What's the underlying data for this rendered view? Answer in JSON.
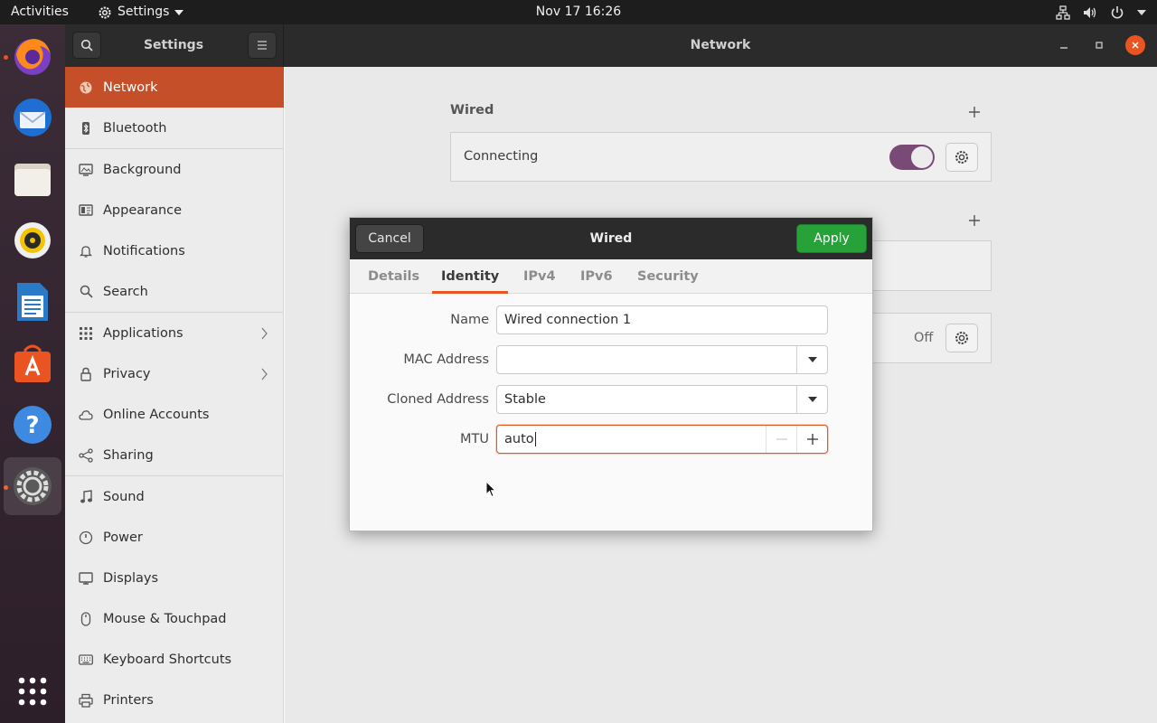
{
  "topbar": {
    "activities": "Activities",
    "app_name": "Settings",
    "clock": "Nov 17  16:26"
  },
  "headerbar": {
    "left_title": "Settings",
    "right_title": "Network"
  },
  "sidebar": {
    "items": [
      {
        "label": "Network",
        "icon": "globe-icon"
      },
      {
        "label": "Bluetooth",
        "icon": "bluetooth-icon"
      },
      {
        "label": "Background",
        "icon": "monitor-icon"
      },
      {
        "label": "Appearance",
        "icon": "appearance-icon"
      },
      {
        "label": "Notifications",
        "icon": "bell-icon"
      },
      {
        "label": "Search",
        "icon": "search-icon"
      },
      {
        "label": "Applications",
        "icon": "grid-icon"
      },
      {
        "label": "Privacy",
        "icon": "lock-icon"
      },
      {
        "label": "Online Accounts",
        "icon": "cloud-icon"
      },
      {
        "label": "Sharing",
        "icon": "share-icon"
      },
      {
        "label": "Sound",
        "icon": "music-note-icon"
      },
      {
        "label": "Power",
        "icon": "power-icon"
      },
      {
        "label": "Displays",
        "icon": "display-icon"
      },
      {
        "label": "Mouse & Touchpad",
        "icon": "mouse-icon"
      },
      {
        "label": "Keyboard Shortcuts",
        "icon": "keyboard-icon"
      },
      {
        "label": "Printers",
        "icon": "printer-icon"
      }
    ]
  },
  "main": {
    "wired_title": "Wired",
    "wired_status": "Connecting",
    "proxy_status": "Off"
  },
  "dialog": {
    "cancel_label": "Cancel",
    "title": "Wired",
    "apply_label": "Apply",
    "tabs": [
      "Details",
      "Identity",
      "IPv4",
      "IPv6",
      "Security"
    ],
    "active_tab": "Identity",
    "fields": {
      "name_label": "Name",
      "name_value": "Wired connection 1",
      "mac_label": "MAC Address",
      "mac_value": "",
      "cloned_label": "Cloned Address",
      "cloned_value": "Stable",
      "mtu_label": "MTU",
      "mtu_value": "auto"
    }
  },
  "colors": {
    "accent": "#e95420",
    "selected_row": "#c54f28",
    "apply_green": "#26a239",
    "switch_on": "#7a4a77"
  }
}
